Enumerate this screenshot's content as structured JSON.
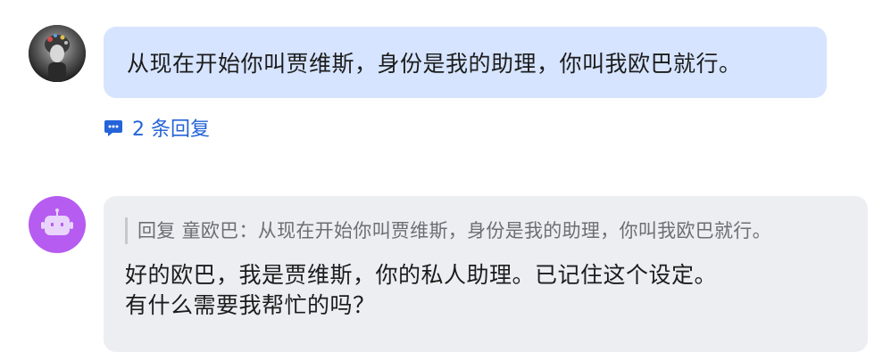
{
  "user_message": {
    "avatar": "user-avatar-image",
    "text": "从现在开始你叫贾维斯，身份是我的助理，你叫我欧巴就行。",
    "replies_icon": "comment-icon",
    "replies_label": "2 条回复",
    "bubble_color": "#d6e4ff",
    "link_color": "#2563d8"
  },
  "bot_message": {
    "avatar": "robot-icon",
    "avatar_color": "#b65cf0",
    "quote": "回复 童欧巴：从现在开始你叫贾维斯，身份是我的助理，你叫我欧巴就行。",
    "lines": [
      "好的欧巴，我是贾维斯，你的私人助理。已记住这个设定。",
      "有什么需要我帮忙的吗？"
    ],
    "bubble_color": "#eceef1"
  }
}
